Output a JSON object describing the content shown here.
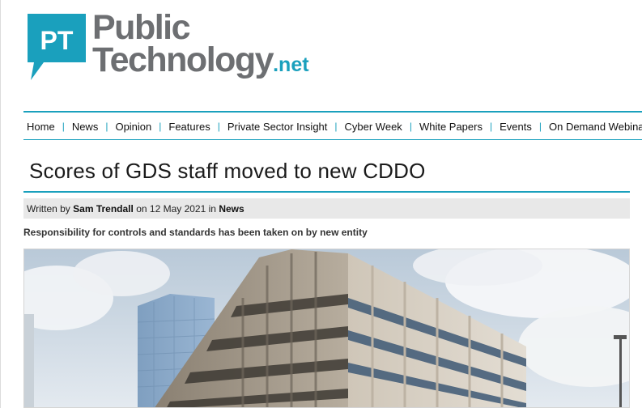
{
  "logo": {
    "mark_text": "PT",
    "line1": "Public",
    "line2": "Technology",
    "suffix": ".net"
  },
  "nav": {
    "items": [
      {
        "label": "Home"
      },
      {
        "label": "News"
      },
      {
        "label": "Opinion"
      },
      {
        "label": "Features"
      },
      {
        "label": "Private Sector Insight"
      },
      {
        "label": "Cyber Week"
      },
      {
        "label": "White Papers"
      },
      {
        "label": "Events"
      },
      {
        "label": "On Demand Webinar"
      }
    ]
  },
  "article": {
    "title": "Scores of GDS staff moved to new CDDO",
    "meta": {
      "written_by": "Written by",
      "author": "Sam Trendall",
      "on": "on",
      "date": "12 May 2021",
      "in": "in",
      "section": "News"
    },
    "standfirst": "Responsibility for controls and standards has been taken on by new entity"
  },
  "colors": {
    "accent": "#1aa0bd",
    "logo_grey": "#6d6f72",
    "meta_bg": "#e8e8e8"
  },
  "icons": {
    "logo_mark": "speech-bubble-logo-icon"
  }
}
